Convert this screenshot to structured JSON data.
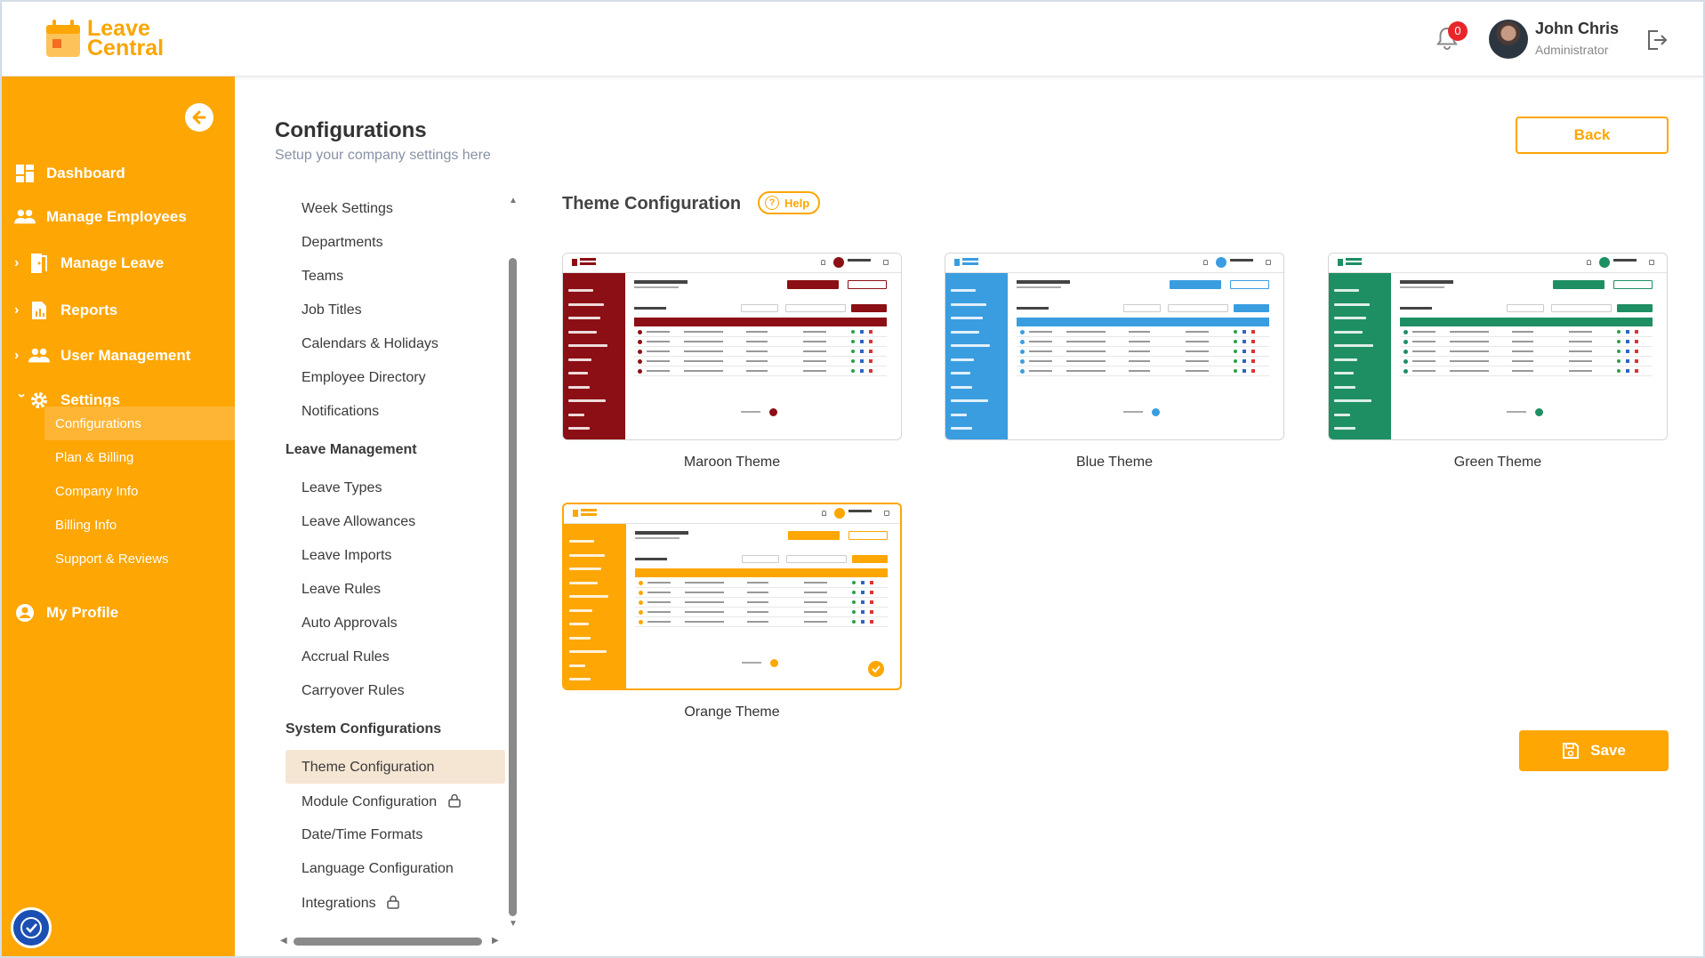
{
  "header": {
    "logo_line1": "Leave",
    "logo_line2": "Central",
    "notification_count": "0",
    "user_name": "John Chris",
    "user_role": "Administrator"
  },
  "sidebar": {
    "items": [
      {
        "label": "Dashboard",
        "icon": "dashboard-icon"
      },
      {
        "label": "Manage Employees",
        "icon": "users-icon"
      },
      {
        "label": "Manage Leave",
        "icon": "door-icon"
      },
      {
        "label": "Reports",
        "icon": "reports-icon"
      },
      {
        "label": "User Management",
        "icon": "user-management-icon"
      },
      {
        "label": "Settings",
        "icon": "gear-icon"
      }
    ],
    "settings_sub": [
      "Configurations",
      "Plan & Billing",
      "Company Info",
      "Billing Info",
      "Support & Reviews"
    ],
    "profile": "My Profile"
  },
  "page": {
    "title": "Configurations",
    "subtitle": "Setup your company settings here",
    "back_label": "Back",
    "save_label": "Save"
  },
  "menu": {
    "general": [
      "Week Settings",
      "Departments",
      "Teams",
      "Job Titles",
      "Calendars & Holidays",
      "Employee Directory",
      "Notifications"
    ],
    "leave_heading": "Leave Management",
    "leave": [
      "Leave Types",
      "Leave Allowances",
      "Leave Imports",
      "Leave Rules",
      "Auto Approvals",
      "Accrual Rules",
      "Carryover Rules"
    ],
    "system_heading": "System Configurations",
    "system": [
      "Theme Configuration",
      "Module Configuration",
      "Date/Time Formats",
      "Language Configuration",
      "Integrations"
    ]
  },
  "theme": {
    "section_title": "Theme Configuration",
    "help_label": "Help",
    "themes": [
      {
        "label": "Maroon Theme",
        "color": "#8b0f14",
        "selected": false
      },
      {
        "label": "Blue Theme",
        "color": "#3a9de0",
        "selected": false
      },
      {
        "label": "Green Theme",
        "color": "#1e8f63",
        "selected": false
      },
      {
        "label": "Orange Theme",
        "color": "#fda604",
        "selected": true
      }
    ]
  },
  "colors": {
    "accent": "#fda604",
    "sidebar_active": "#fdb533",
    "menu_active": "#f5e6d3",
    "badge": "#e8262a"
  }
}
